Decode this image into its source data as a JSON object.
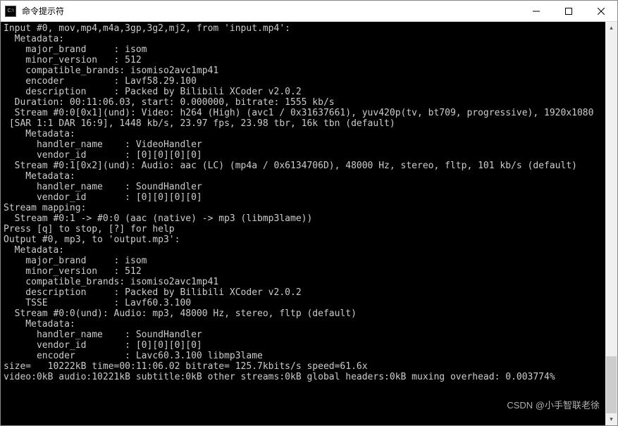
{
  "window": {
    "title": "命令提示符",
    "icon_text": "C:\\"
  },
  "terminal": {
    "lines": [
      "Input #0, mov,mp4,m4a,3gp,3g2,mj2, from 'input.mp4':",
      "  Metadata:",
      "    major_brand     : isom",
      "    minor_version   : 512",
      "    compatible_brands: isomiso2avc1mp41",
      "    encoder         : Lavf58.29.100",
      "    description     : Packed by Bilibili XCoder v2.0.2",
      "  Duration: 00:11:06.03, start: 0.000000, bitrate: 1555 kb/s",
      "  Stream #0:0[0x1](und): Video: h264 (High) (avc1 / 0x31637661), yuv420p(tv, bt709, progressive), 1920x1080",
      " [SAR 1:1 DAR 16:9], 1448 kb/s, 23.97 fps, 23.98 tbr, 16k tbn (default)",
      "    Metadata:",
      "      handler_name    : VideoHandler",
      "      vendor_id       : [0][0][0][0]",
      "  Stream #0:1[0x2](und): Audio: aac (LC) (mp4a / 0x6134706D), 48000 Hz, stereo, fltp, 101 kb/s (default)",
      "    Metadata:",
      "      handler_name    : SoundHandler",
      "      vendor_id       : [0][0][0][0]",
      "Stream mapping:",
      "  Stream #0:1 -> #0:0 (aac (native) -> mp3 (libmp3lame))",
      "Press [q] to stop, [?] for help",
      "Output #0, mp3, to 'output.mp3':",
      "  Metadata:",
      "    major_brand     : isom",
      "    minor_version   : 512",
      "    compatible_brands: isomiso2avc1mp41",
      "    description     : Packed by Bilibili XCoder v2.0.2",
      "    TSSE            : Lavf60.3.100",
      "  Stream #0:0(und): Audio: mp3, 48000 Hz, stereo, fltp (default)",
      "    Metadata:",
      "      handler_name    : SoundHandler",
      "      vendor_id       : [0][0][0][0]",
      "      encoder         : Lavc60.3.100 libmp3lame",
      "size=   10222kB time=00:11:06.02 bitrate= 125.7kbits/s speed=61.6x",
      "video:0kB audio:10221kB subtitle:0kB other streams:0kB global headers:0kB muxing overhead: 0.003774%"
    ]
  },
  "watermark": "CSDN @小手智联老徐"
}
